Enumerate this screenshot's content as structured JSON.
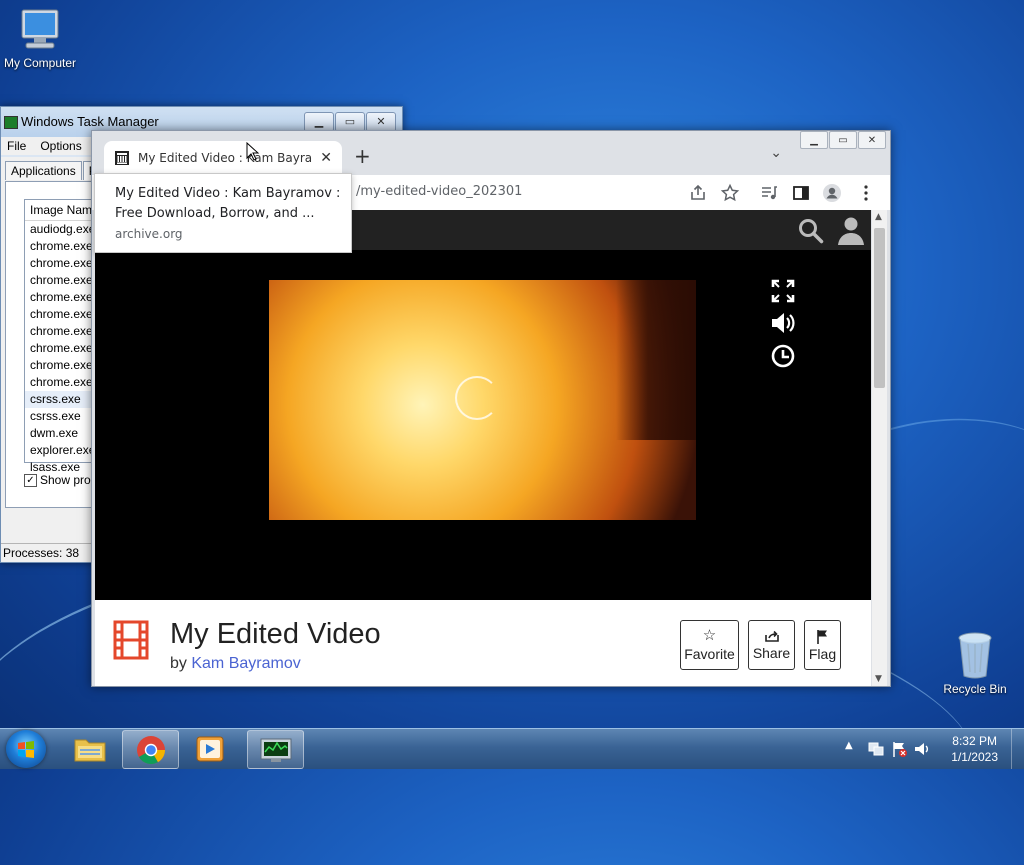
{
  "desktop": {
    "icons": [
      {
        "label": "My Computer"
      },
      {
        "label": "Recycle Bin"
      }
    ]
  },
  "task_manager": {
    "title": "Windows Task Manager",
    "menu": [
      "File",
      "Options"
    ],
    "tabs": [
      "Applications",
      "Pr"
    ],
    "column_header": "Image Name",
    "processes": [
      "audiodg.exe",
      "chrome.exe",
      "chrome.exe",
      "chrome.exe",
      "chrome.exe",
      "chrome.exe",
      "chrome.exe",
      "chrome.exe",
      "chrome.exe",
      "chrome.exe",
      "csrss.exe",
      "csrss.exe",
      "dwm.exe",
      "explorer.exe",
      "lsass.exe"
    ],
    "selected_index": 10,
    "show_processes_label": "Show proce",
    "status": "Processes: 38"
  },
  "browser": {
    "tab_title": "My Edited Video : Kam Bayramov",
    "url_text": "/my-edited-video_202301",
    "tooltip": {
      "title_line1": "My Edited Video : Kam Bayramov :",
      "title_line2": "Free Download, Borrow, and ...",
      "domain": "archive.org"
    }
  },
  "page": {
    "title": "My Edited Video",
    "by_prefix": "by ",
    "author": "Kam Bayramov",
    "actions": [
      {
        "label": "Favorite",
        "icon": "star-icon"
      },
      {
        "label": "Share",
        "icon": "share-icon"
      },
      {
        "label": "Flag",
        "icon": "flag-icon"
      }
    ]
  },
  "taskbar": {
    "time": "8:32 PM",
    "date": "1/1/2023"
  },
  "colors": {
    "author_link": "#4b64d2",
    "film_icon": "#e4472b"
  }
}
